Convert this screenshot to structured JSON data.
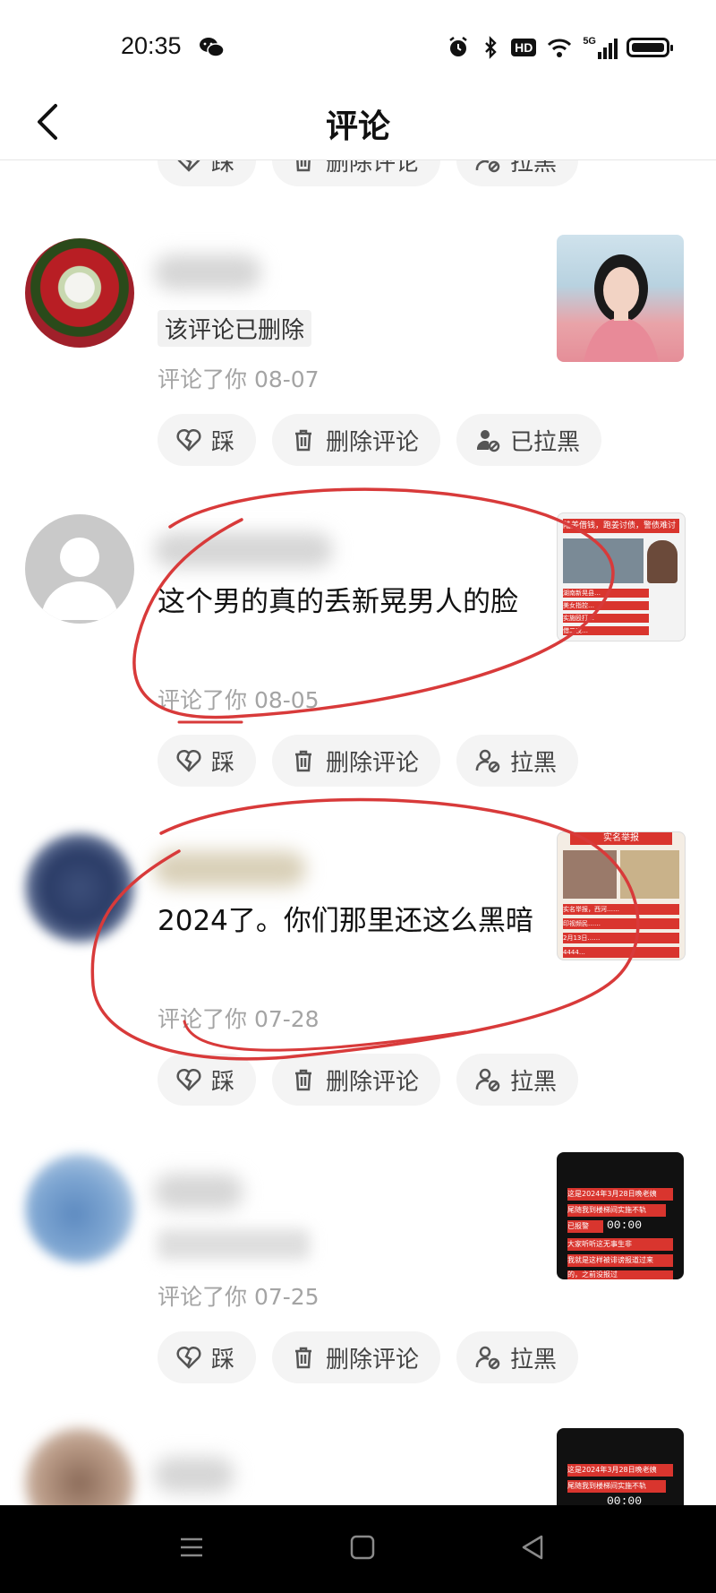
{
  "status": {
    "time": "20:35",
    "network": "5G",
    "hd": "HD"
  },
  "header": {
    "title": "评论"
  },
  "actions_labels": {
    "dislike": "踩",
    "delete": "删除评论",
    "block": "拉黑",
    "blocked": "已拉黑"
  },
  "comments": [
    {
      "deleted_text": "该评论已删除",
      "meta": "评论了你 08-07"
    },
    {
      "text": "这个男的真的丢新晃男人的脸",
      "meta": "评论了你 08-05"
    },
    {
      "text": "2024了。你们那里还这么黑暗",
      "meta": "评论了你 07-28"
    },
    {
      "meta": "评论了你 07-25"
    }
  ],
  "thumbs": {
    "t2_lines": [
      "陆姜借钱，跑姜讨债，警债难讨",
      "湖南新晃县…",
      "美女指控…",
      "实施殴打…",
      "借二夜…"
    ],
    "t3_lines": [
      "实名举报",
      "实名举报，西河……",
      "印视频民……",
      "2月13日……",
      "4444…"
    ],
    "t4_lines": [
      "这是2024年3月28日晚老姨",
      "尾随我到楼梯间实施不轨",
      "已报警",
      "00:00",
      "大家听听这无事生非",
      "我就是这样被诽谤报道过来",
      "的，之前没报过"
    ],
    "t5_lines": [
      "这是2024年3月28日晚老姨",
      "尾随我到楼梯间实施不轨",
      "00:00"
    ]
  },
  "colors": {
    "annotation": "#d83a3a",
    "meta": "#a4a4a4",
    "btn_bg": "#f4f4f4"
  },
  "icons": [
    "heart-broken-icon",
    "trash-icon",
    "user-block-icon",
    "back-arrow-icon",
    "menu-icon",
    "home-icon",
    "back-triangle-icon"
  ]
}
